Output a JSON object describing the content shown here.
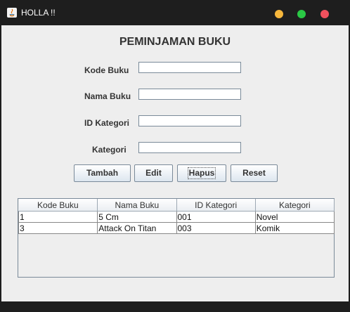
{
  "window": {
    "title": "HOLLA !!"
  },
  "form": {
    "heading": "PEMINJAMAN BUKU",
    "fields": [
      {
        "label": "Kode Buku",
        "value": ""
      },
      {
        "label": "Nama Buku",
        "value": ""
      },
      {
        "label": "ID Kategori",
        "value": ""
      },
      {
        "label": "Kategori",
        "value": ""
      }
    ]
  },
  "buttons": {
    "tambah": "Tambah",
    "edit": "Edit",
    "hapus": "Hapus",
    "reset": "Reset"
  },
  "table": {
    "columns": [
      "Kode Buku",
      "Nama Buku",
      "ID Kategori",
      "Kategori"
    ],
    "rows": [
      [
        "1",
        "5 Cm",
        "001",
        "Novel"
      ],
      [
        "3",
        "Attack On Titan",
        "003",
        "Komik"
      ]
    ]
  },
  "colors": {
    "titlebar": "#1e1e1e",
    "background": "#eeeeee",
    "dot_minimize": "#f6b73c",
    "dot_maximize": "#2ac845",
    "dot_close": "#f0505d"
  }
}
